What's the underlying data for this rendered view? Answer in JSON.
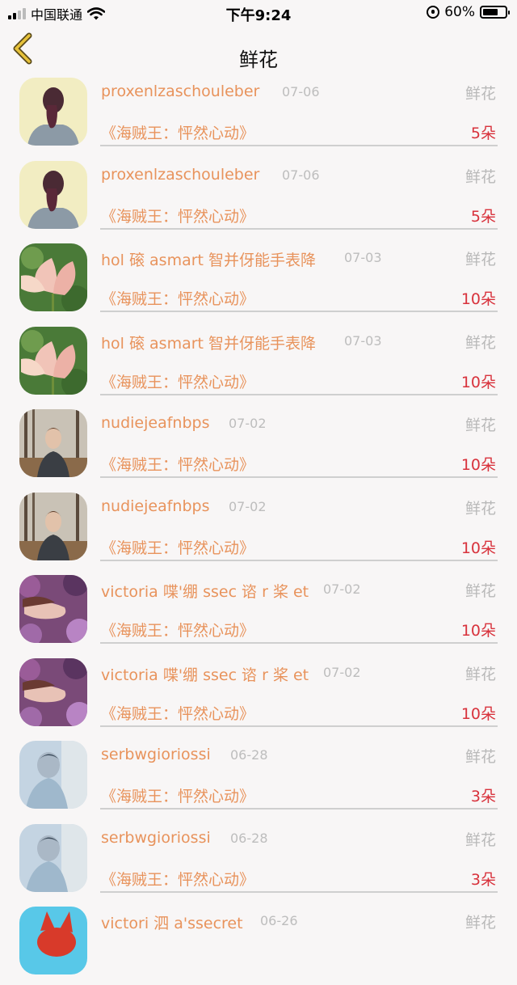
{
  "status_bar": {
    "carrier": "中国联通",
    "time": "下午9:24",
    "battery": "60%",
    "battery_level": 0.6
  },
  "nav": {
    "title": "鲜花",
    "back_icon": "chevron-left-icon"
  },
  "colors": {
    "accent": "#e8935c",
    "count": "#d8323c",
    "muted": "#bdbdbd",
    "background": "#f8f6f6"
  },
  "items": [
    {
      "name": "proxenlzaschouleber",
      "date": "07-06",
      "gift": "鲜花",
      "book": "《海贼王：怦然心动》",
      "count": "5朵",
      "avatar": "woman-back-photo"
    },
    {
      "name": "proxenlzaschouleber",
      "date": "07-06",
      "gift": "鲜花",
      "book": "《海贼王：怦然心动》",
      "count": "5朵",
      "avatar": "woman-back-photo"
    },
    {
      "name": "hol 磙 asmart 智并伢能手表降",
      "date": "07-03",
      "gift": "鲜花",
      "book": "《海贼王：怦然心动》",
      "count": "10朵",
      "avatar": "lotus-photo"
    },
    {
      "name": "hol 磙 asmart 智并伢能手表降",
      "date": "07-03",
      "gift": "鲜花",
      "book": "《海贼王：怦然心动》",
      "count": "10朵",
      "avatar": "lotus-photo"
    },
    {
      "name": "nudiejeafnbps",
      "date": "07-02",
      "gift": "鲜花",
      "book": "《海贼王：怦然心动》",
      "count": "10朵",
      "avatar": "man-forest-photo"
    },
    {
      "name": "nudiejeafnbps",
      "date": "07-02",
      "gift": "鲜花",
      "book": "《海贼王：怦然心动》",
      "count": "10朵",
      "avatar": "man-forest-photo"
    },
    {
      "name": "victoria 喋'绷 ssec 谘 r 桨 et",
      "date": "07-02",
      "gift": "鲜花",
      "book": "《海贼王：怦然心动》",
      "count": "10朵",
      "avatar": "woman-flowers-photo"
    },
    {
      "name": "victoria 喋'绷 ssec 谘 r 桨 et",
      "date": "07-02",
      "gift": "鲜花",
      "book": "《海贼王：怦然心动》",
      "count": "10朵",
      "avatar": "woman-flowers-photo"
    },
    {
      "name": "serbwgioriossi",
      "date": "06-28",
      "gift": "鲜花",
      "book": "《海贼王：怦然心动》",
      "count": "3朵",
      "avatar": "blurred-person-photo"
    },
    {
      "name": "serbwgioriossi",
      "date": "06-28",
      "gift": "鲜花",
      "book": "《海贼王：怦然心动》",
      "count": "3朵",
      "avatar": "blurred-person-photo"
    },
    {
      "name": "victori 泗 a'ssecret",
      "date": "06-26",
      "gift": "鲜花",
      "book": "",
      "count": "",
      "avatar": "cartoon-cat-photo"
    }
  ]
}
